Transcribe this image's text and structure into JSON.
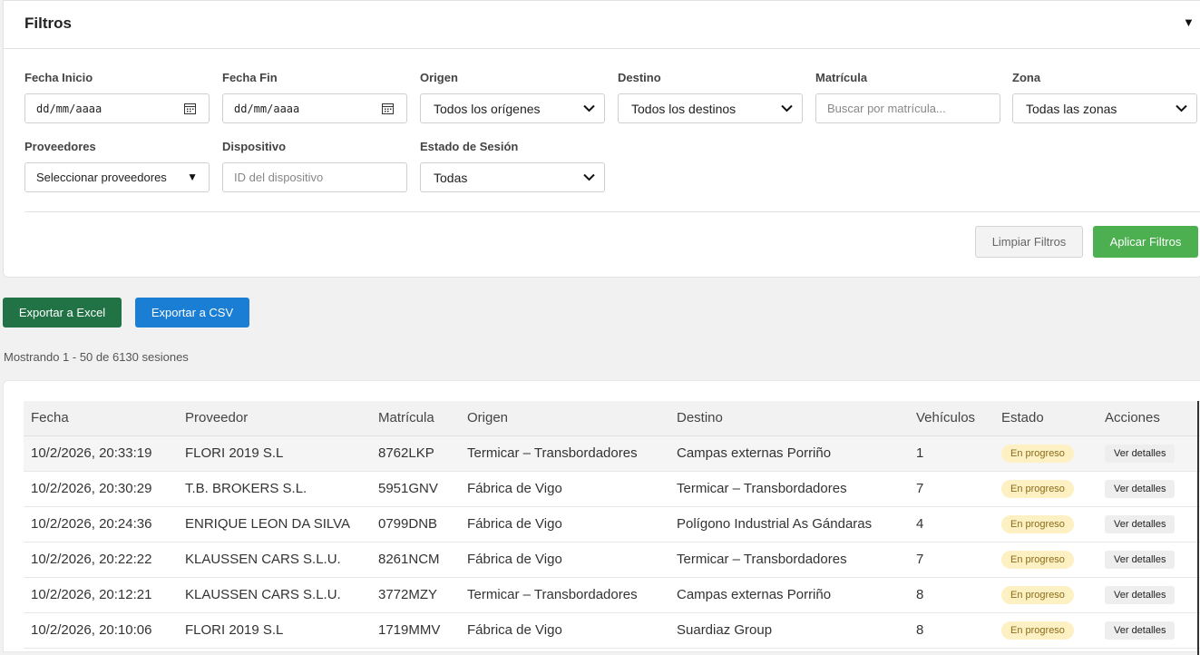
{
  "filters": {
    "title": "Filtros",
    "fecha_inicio": {
      "label": "Fecha Inicio",
      "value": "dd/mm/aaaa"
    },
    "fecha_fin": {
      "label": "Fecha Fin",
      "value": "dd/mm/aaaa"
    },
    "origen": {
      "label": "Origen",
      "value": "Todos los orígenes"
    },
    "destino": {
      "label": "Destino",
      "value": "Todos los destinos"
    },
    "matricula": {
      "label": "Matrícula",
      "placeholder": "Buscar por matrícula..."
    },
    "zona": {
      "label": "Zona",
      "value": "Todas las zonas"
    },
    "proveedores": {
      "label": "Proveedores",
      "value": "Seleccionar proveedores"
    },
    "dispositivo": {
      "label": "Dispositivo",
      "placeholder": "ID del dispositivo"
    },
    "estado_sesion": {
      "label": "Estado de Sesión",
      "value": "Todas"
    },
    "clear_label": "Limpiar Filtros",
    "apply_label": "Aplicar Filtros"
  },
  "export": {
    "excel_label": "Exportar a Excel",
    "csv_label": "Exportar a CSV"
  },
  "result_count": "Mostrando 1 - 50 de 6130 sesiones",
  "table": {
    "headers": [
      "Fecha",
      "Proveedor",
      "Matrícula",
      "Origen",
      "Destino",
      "Vehículos",
      "Estado",
      "Acciones"
    ],
    "rows": [
      {
        "fecha": "10/2/2026, 20:33:19",
        "proveedor": "FLORI 2019 S.L",
        "matricula": "8762LKP",
        "origen": "Termicar – Transbordadores",
        "destino": "Campas externas Porriño",
        "vehiculos": "1",
        "estado": "En progreso",
        "accion": "Ver detalles"
      },
      {
        "fecha": "10/2/2026, 20:30:29",
        "proveedor": "T.B. BROKERS S.L.",
        "matricula": "5951GNV",
        "origen": "Fábrica de Vigo",
        "destino": "Termicar – Transbordadores",
        "vehiculos": "7",
        "estado": "En progreso",
        "accion": "Ver detalles"
      },
      {
        "fecha": "10/2/2026, 20:24:36",
        "proveedor": "ENRIQUE LEON DA SILVA",
        "matricula": "0799DNB",
        "origen": "Fábrica de Vigo",
        "destino": "Polígono Industrial As Gándaras",
        "vehiculos": "4",
        "estado": "En progreso",
        "accion": "Ver detalles"
      },
      {
        "fecha": "10/2/2026, 20:22:22",
        "proveedor": "KLAUSSEN CARS S.L.U.",
        "matricula": "8261NCM",
        "origen": "Fábrica de Vigo",
        "destino": "Termicar – Transbordadores",
        "vehiculos": "7",
        "estado": "En progreso",
        "accion": "Ver detalles"
      },
      {
        "fecha": "10/2/2026, 20:12:21",
        "proveedor": "KLAUSSEN CARS S.L.U.",
        "matricula": "3772MZY",
        "origen": "Termicar – Transbordadores",
        "destino": "Campas externas Porriño",
        "vehiculos": "8",
        "estado": "En progreso",
        "accion": "Ver detalles"
      },
      {
        "fecha": "10/2/2026, 20:10:06",
        "proveedor": "FLORI 2019 S.L",
        "matricula": "1719MMV",
        "origen": "Fábrica de Vigo",
        "destino": "Suardiaz Group",
        "vehiculos": "8",
        "estado": "En progreso",
        "accion": "Ver detalles"
      }
    ]
  },
  "colors": {
    "apply": "#4caf50",
    "excel": "#217346",
    "csv": "#1a7fd4",
    "badge_bg": "#fdf0c2"
  }
}
